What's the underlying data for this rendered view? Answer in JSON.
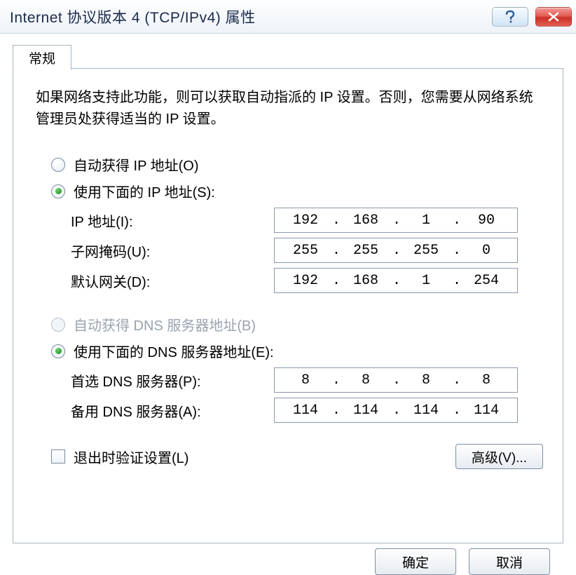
{
  "title": "Internet 协议版本 4 (TCP/IPv4) 属性",
  "tab": "常规",
  "intro": "如果网络支持此功能，则可以获取自动指派的 IP 设置。否则，您需要从网络系统管理员处获得适当的 IP 设置。",
  "ip": {
    "auto_label": "自动获得 IP 地址(O)",
    "manual_label": "使用下面的 IP 地址(S):",
    "fields": {
      "addr_label": "IP 地址(I):",
      "mask_label": "子网掩码(U):",
      "gw_label": "默认网关(D):",
      "addr": [
        "192",
        "168",
        "1",
        "90"
      ],
      "mask": [
        "255",
        "255",
        "255",
        "0"
      ],
      "gw": [
        "192",
        "168",
        "1",
        "254"
      ]
    }
  },
  "dns": {
    "auto_label": "自动获得 DNS 服务器地址(B)",
    "manual_label": "使用下面的 DNS 服务器地址(E):",
    "pref_label": "首选 DNS 服务器(P):",
    "alt_label": "备用 DNS 服务器(A):",
    "pref": [
      "8",
      "8",
      "8",
      "8"
    ],
    "alt": [
      "114",
      "114",
      "114",
      "114"
    ]
  },
  "validate_label": "退出时验证设置(L)",
  "advanced_label": "高级(V)...",
  "ok_label": "确定",
  "cancel_label": "取消"
}
